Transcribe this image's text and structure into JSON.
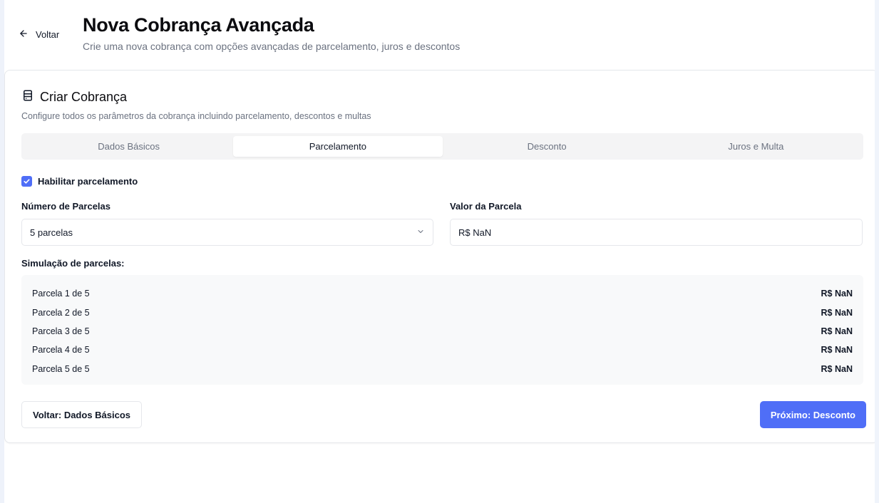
{
  "header": {
    "back_label": "Voltar",
    "title": "Nova Cobrança Avançada",
    "subtitle": "Crie uma nova cobrança com opções avançadas de parcelamento, juros e descontos"
  },
  "card": {
    "title": "Criar Cobrança",
    "description": "Configure todos os parâmetros da cobrança incluindo parcelamento, descontos e multas",
    "icon": "receipt-icon"
  },
  "tabs": [
    {
      "label": "Dados Básicos",
      "active": false
    },
    {
      "label": "Parcelamento",
      "active": true
    },
    {
      "label": "Desconto",
      "active": false
    },
    {
      "label": "Juros e Multa",
      "active": false
    }
  ],
  "installments": {
    "enable_label": "Habilitar parcelamento",
    "enabled": true,
    "count_label": "Número de Parcelas",
    "count_value": "5 parcelas",
    "value_label": "Valor da Parcela",
    "value_value": "R$ NaN",
    "simulation_label": "Simulação de parcelas:",
    "simulation": [
      {
        "label": "Parcela 1 de 5",
        "amount": "R$ NaN"
      },
      {
        "label": "Parcela 2 de 5",
        "amount": "R$ NaN"
      },
      {
        "label": "Parcela 3 de 5",
        "amount": "R$ NaN"
      },
      {
        "label": "Parcela 4 de 5",
        "amount": "R$ NaN"
      },
      {
        "label": "Parcela 5 de 5",
        "amount": "R$ NaN"
      }
    ]
  },
  "footer": {
    "back_button": "Voltar: Dados Básicos",
    "next_button": "Próximo: Desconto"
  },
  "colors": {
    "accent": "#4f6ef7",
    "tab_bg": "#f4f4f5",
    "muted_text": "#6b7280"
  }
}
